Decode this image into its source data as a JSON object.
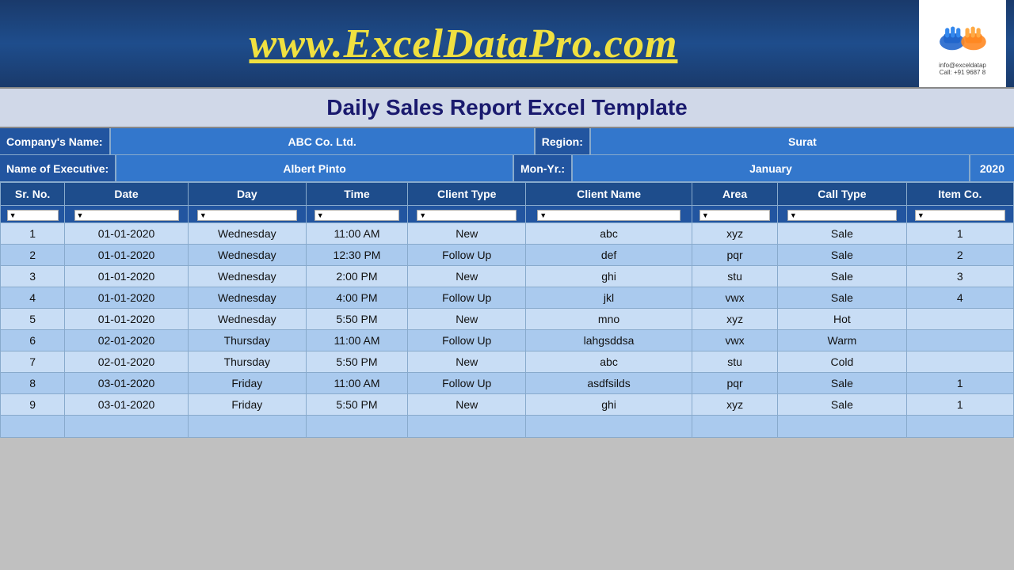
{
  "header": {
    "website": "www.ExcelDataPro.com",
    "logo_line1": "info@exceldatap",
    "logo_line2": "Call: +91 9687 8"
  },
  "report": {
    "title": "Daily Sales Report Excel Template"
  },
  "company_info": {
    "company_label": "Company's Name:",
    "company_value": "ABC Co. Ltd.",
    "region_label": "Region:",
    "region_value": "Surat",
    "executive_label": "Name of Executive:",
    "executive_value": "Albert Pinto",
    "month_label": "Mon-Yr.:",
    "month_value": "January",
    "year_value": "2020"
  },
  "columns": {
    "sr_no": "Sr. No.",
    "date": "Date",
    "day": "Day",
    "time": "Time",
    "client_type": "Client Type",
    "client_name": "Client Name",
    "area": "Area",
    "call_type": "Call Type",
    "item_code": "Item Co."
  },
  "rows": [
    {
      "sr": "1",
      "date": "01-01-2020",
      "day": "Wednesday",
      "time": "11:00 AM",
      "client_type": "New",
      "client_name": "abc",
      "area": "xyz",
      "call_type": "Sale",
      "item_code": "1"
    },
    {
      "sr": "2",
      "date": "01-01-2020",
      "day": "Wednesday",
      "time": "12:30 PM",
      "client_type": "Follow Up",
      "client_name": "def",
      "area": "pqr",
      "call_type": "Sale",
      "item_code": "2"
    },
    {
      "sr": "3",
      "date": "01-01-2020",
      "day": "Wednesday",
      "time": "2:00 PM",
      "client_type": "New",
      "client_name": "ghi",
      "area": "stu",
      "call_type": "Sale",
      "item_code": "3"
    },
    {
      "sr": "4",
      "date": "01-01-2020",
      "day": "Wednesday",
      "time": "4:00 PM",
      "client_type": "Follow Up",
      "client_name": "jkl",
      "area": "vwx",
      "call_type": "Sale",
      "item_code": "4"
    },
    {
      "sr": "5",
      "date": "01-01-2020",
      "day": "Wednesday",
      "time": "5:50 PM",
      "client_type": "New",
      "client_name": "mno",
      "area": "xyz",
      "call_type": "Hot",
      "item_code": ""
    },
    {
      "sr": "6",
      "date": "02-01-2020",
      "day": "Thursday",
      "time": "11:00 AM",
      "client_type": "Follow Up",
      "client_name": "lahgsddsa",
      "area": "vwx",
      "call_type": "Warm",
      "item_code": ""
    },
    {
      "sr": "7",
      "date": "02-01-2020",
      "day": "Thursday",
      "time": "5:50 PM",
      "client_type": "New",
      "client_name": "abc",
      "area": "stu",
      "call_type": "Cold",
      "item_code": ""
    },
    {
      "sr": "8",
      "date": "03-01-2020",
      "day": "Friday",
      "time": "11:00 AM",
      "client_type": "Follow Up",
      "client_name": "asdfsilds",
      "area": "pqr",
      "call_type": "Sale",
      "item_code": "1"
    },
    {
      "sr": "9",
      "date": "03-01-2020",
      "day": "Friday",
      "time": "5:50 PM",
      "client_type": "New",
      "client_name": "ghi",
      "area": "xyz",
      "call_type": "Sale",
      "item_code": "1"
    }
  ]
}
